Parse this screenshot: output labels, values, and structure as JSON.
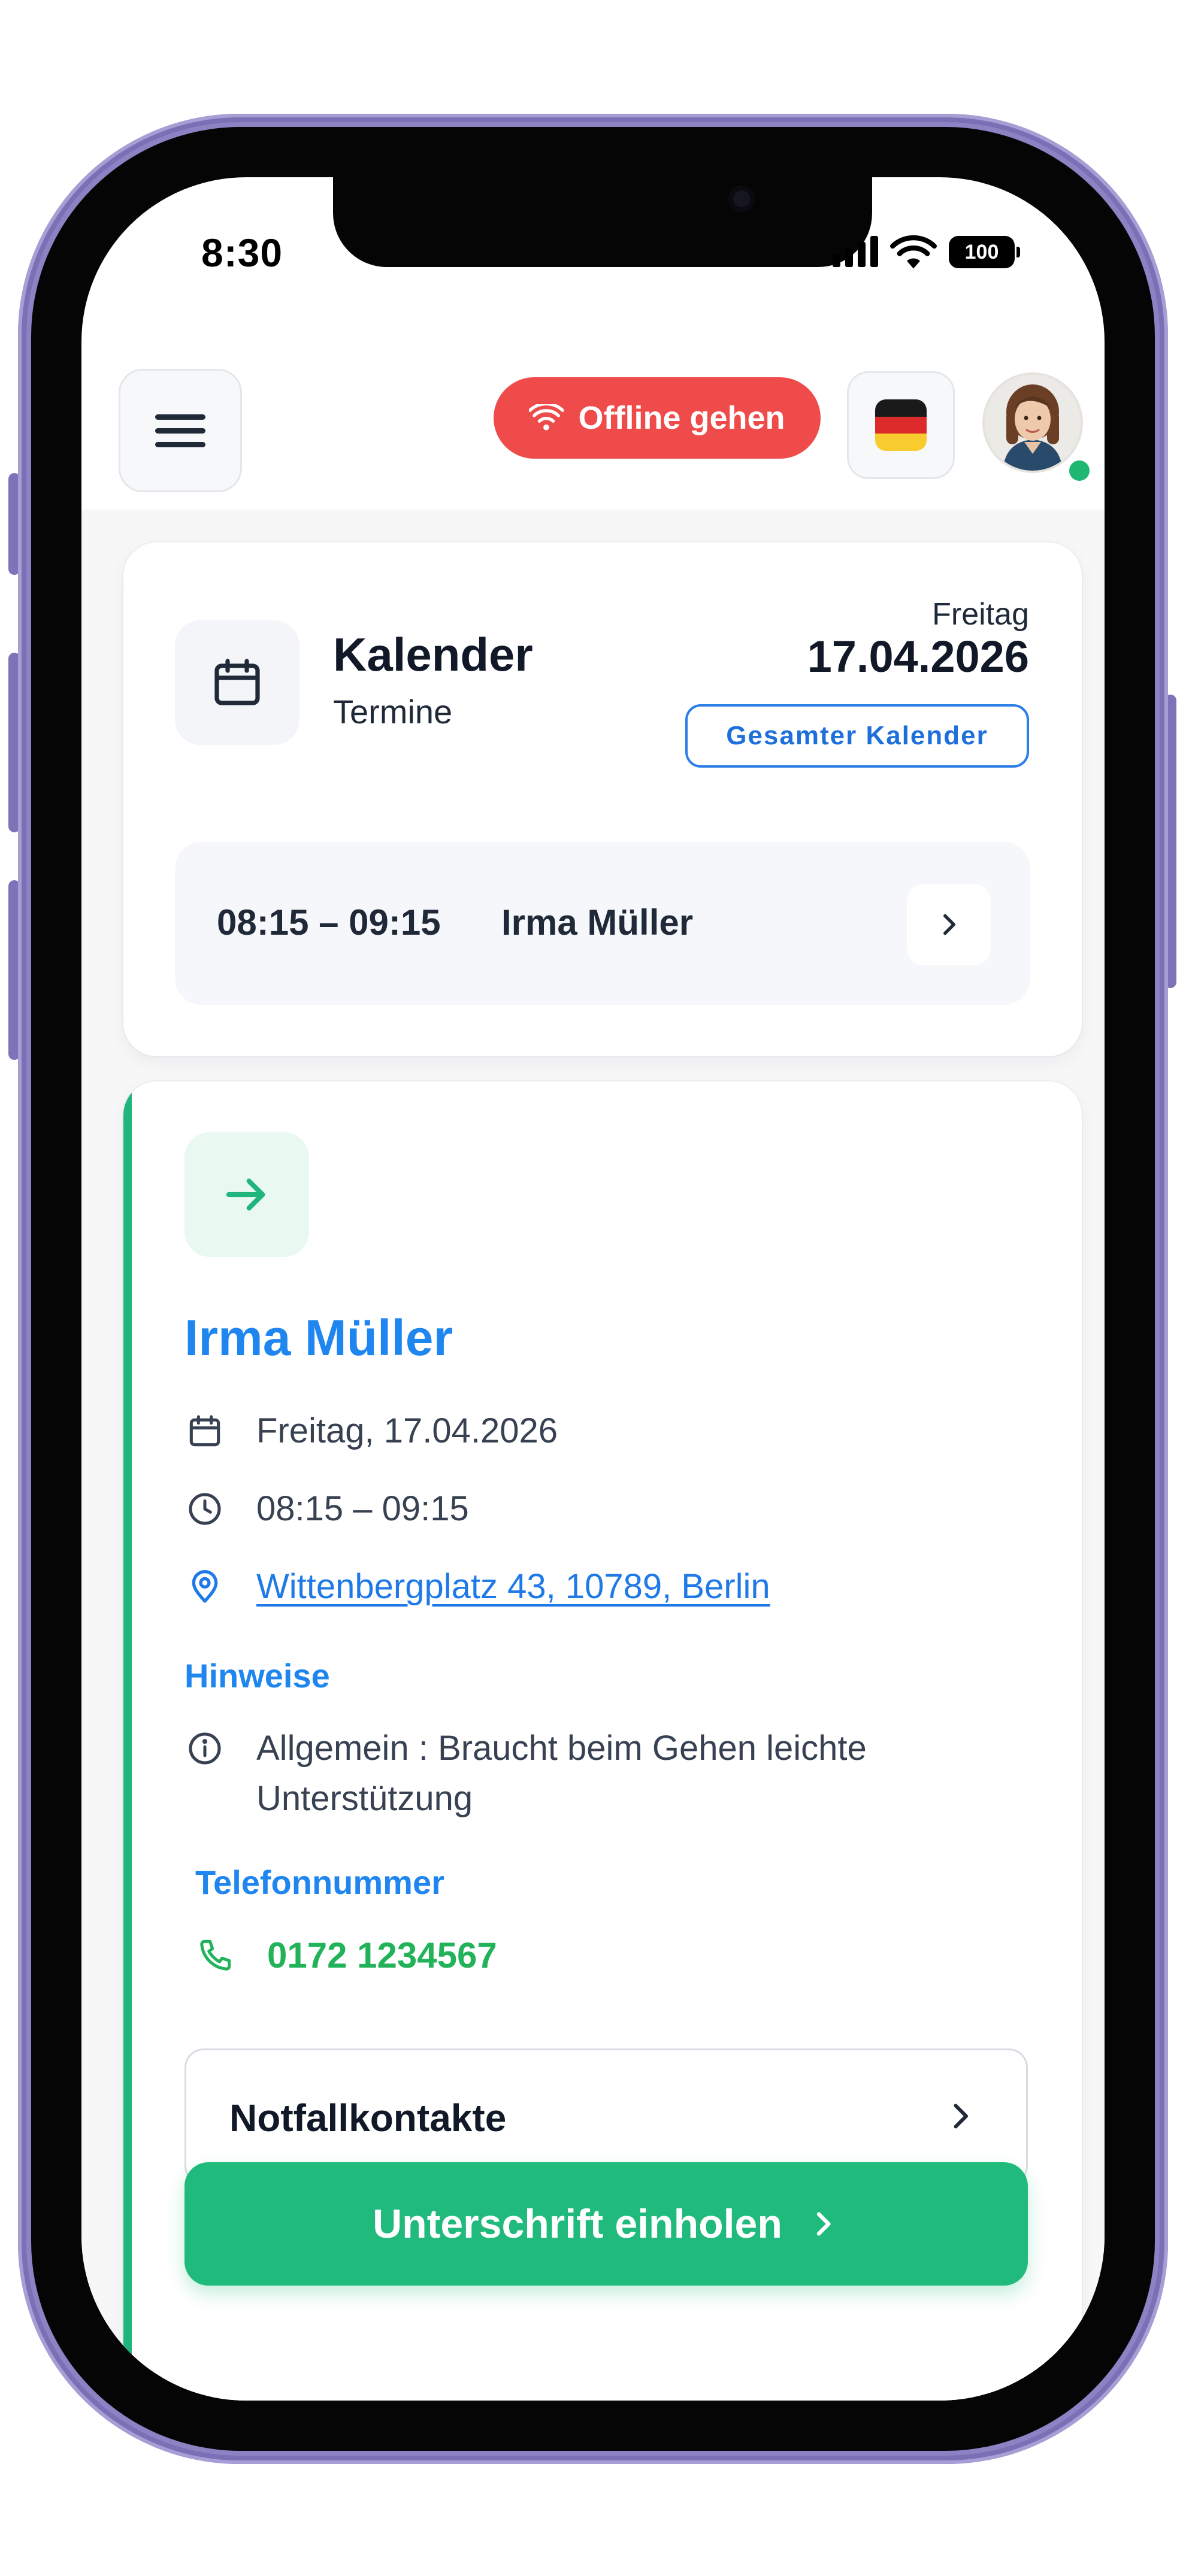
{
  "status_bar": {
    "time": "8:30",
    "battery": "100"
  },
  "header": {
    "offline_button": "Offline gehen",
    "language_flag": "de-flag-icon"
  },
  "calendar": {
    "title": "Kalender",
    "subtitle": "Termine",
    "weekday": "Freitag",
    "date": "17.04.2026",
    "full_calendar_button": "Gesamter Kalender",
    "appointment": {
      "time": "08:15 – 09:15",
      "name": "Irma Müller"
    }
  },
  "patient": {
    "name": "Irma Müller",
    "date": "Freitag, 17.04.2026",
    "time": "08:15 – 09:15",
    "address": "Wittenbergplatz 43, 10789, Berlin",
    "notes_label": "Hinweise",
    "note": "Allgemein : Braucht beim Gehen leichte Unterstützung",
    "phone_label": "Telefonnummer",
    "phone": "0172 1234567",
    "emergency_contacts_button": "Notfallkontakte",
    "signature_button": "Unterschrift einholen"
  },
  "colors": {
    "accent_blue": "#1f86f0",
    "offline_red": "#ef4b4b",
    "success_green": "#1fba7c",
    "phone_frame": "#8e82c4"
  }
}
